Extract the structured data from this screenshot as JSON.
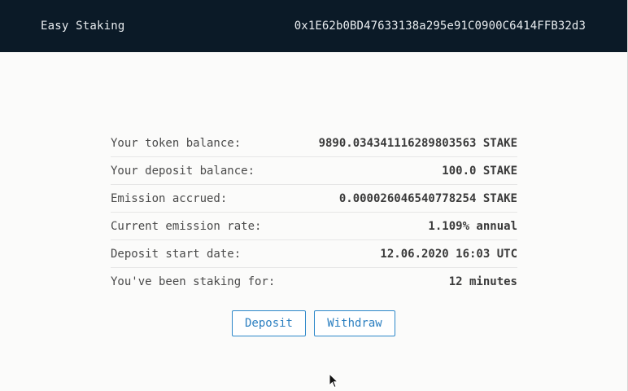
{
  "header": {
    "brand": "Easy Staking",
    "address": "0x1E62b0BD47633138a295e91C0900C6414FFB32d3"
  },
  "info": {
    "rows": [
      {
        "label": "Your token balance:",
        "value": "9890.034341116289803563 STAKE"
      },
      {
        "label": "Your deposit balance:",
        "value": "100.0 STAKE"
      },
      {
        "label": "Emission accrued:",
        "value": "0.000026046540778254 STAKE"
      },
      {
        "label": "Current emission rate:",
        "value": "1.109% annual"
      },
      {
        "label": "Deposit start date:",
        "value": "12.06.2020 16:03 UTC"
      },
      {
        "label": "You've been staking for:",
        "value": "12 minutes"
      }
    ]
  },
  "actions": {
    "deposit_label": "Deposit",
    "withdraw_label": "Withdraw"
  },
  "colors": {
    "header_bg": "#0b1a27",
    "accent": "#2c87c9"
  }
}
